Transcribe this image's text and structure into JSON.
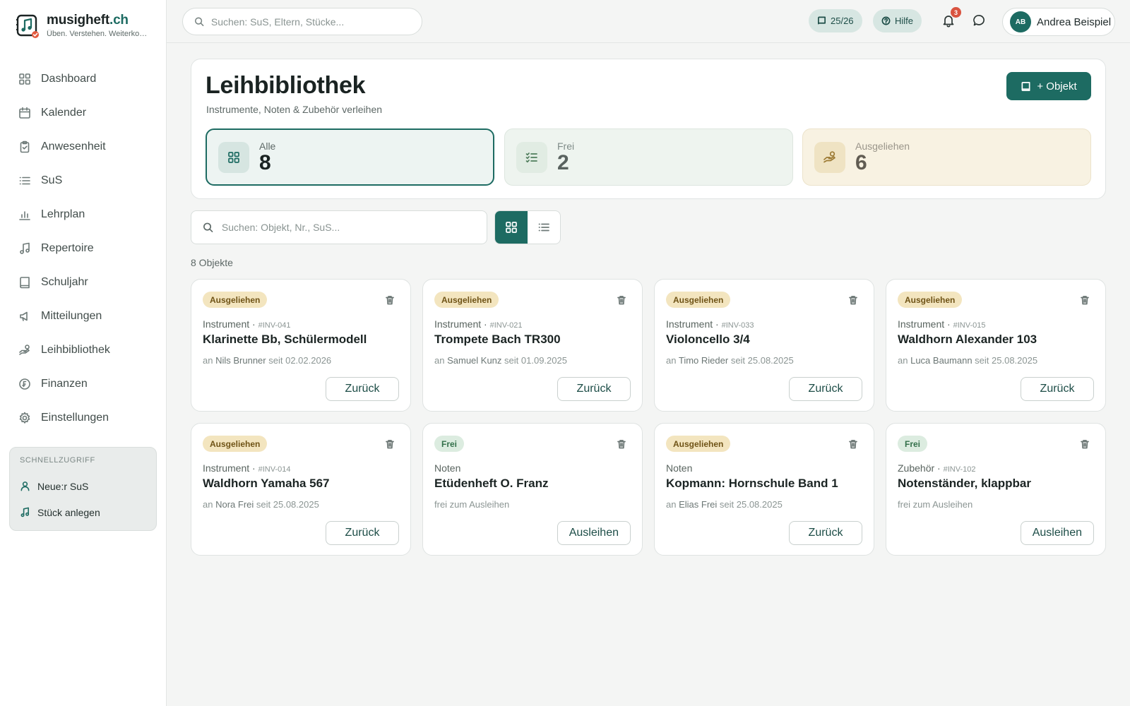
{
  "brand": {
    "name": "musigheft",
    "tld": ".ch",
    "tagline": "Üben. Verstehen. Weiterkommen."
  },
  "topbar": {
    "search_placeholder": "Suchen: SuS, Eltern, Stücke...",
    "term_label": "25/26",
    "help_label": "Hilfe",
    "notifications_count": "3",
    "user_initials": "AB",
    "user_name": "Andrea Beispiel"
  },
  "sidebar": {
    "items": [
      {
        "label": "Dashboard",
        "icon": "dashboard-icon"
      },
      {
        "label": "Kalender",
        "icon": "calendar-icon"
      },
      {
        "label": "Anwesenheit",
        "icon": "clipboard-check-icon"
      },
      {
        "label": "SuS",
        "icon": "list-icon"
      },
      {
        "label": "Lehrplan",
        "icon": "bar-chart-icon"
      },
      {
        "label": "Repertoire",
        "icon": "music-note-icon"
      },
      {
        "label": "Schuljahr",
        "icon": "book-icon"
      },
      {
        "label": "Mitteilungen",
        "icon": "megaphone-icon"
      },
      {
        "label": "Leihbibliothek",
        "icon": "hand-coins-icon"
      },
      {
        "label": "Finanzen",
        "icon": "franc-coin-icon"
      },
      {
        "label": "Einstellungen",
        "icon": "gear-icon"
      }
    ],
    "quick": {
      "title": "SCHNELLZUGRIFF",
      "items": [
        {
          "label": "Neue:r SuS",
          "icon": "user-icon"
        },
        {
          "label": "Stück anlegen",
          "icon": "music-note-icon"
        }
      ]
    }
  },
  "page": {
    "title": "Leihbibliothek",
    "subtitle": "Instrumente, Noten & Zubehör verleihen",
    "add_button": "+ Objekt",
    "stats": {
      "all": {
        "label": "Alle",
        "value": "8"
      },
      "free": {
        "label": "Frei",
        "value": "2"
      },
      "lent": {
        "label": "Ausgeliehen",
        "value": "6"
      }
    },
    "search_placeholder": "Suchen: Objekt, Nr., SuS...",
    "view_mode": "grid",
    "count_text": "8 Objekte"
  },
  "items": [
    {
      "status": "Ausgeliehen",
      "status_kind": "lent",
      "category": "Instrument",
      "inv": "#INV-041",
      "title": "Klarinette Bb, Schülermodell",
      "holder_prefix": "an",
      "holder": "Nils Brunner",
      "since_text": "seit 02.02.2026",
      "action": "Zurück"
    },
    {
      "status": "Ausgeliehen",
      "status_kind": "lent",
      "category": "Instrument",
      "inv": "#INV-021",
      "title": "Trompete Bach TR300",
      "holder_prefix": "an",
      "holder": "Samuel Kunz",
      "since_text": "seit 01.09.2025",
      "action": "Zurück"
    },
    {
      "status": "Ausgeliehen",
      "status_kind": "lent",
      "category": "Instrument",
      "inv": "#INV-033",
      "title": "Violoncello 3/4",
      "holder_prefix": "an",
      "holder": "Timo Rieder",
      "since_text": "seit 25.08.2025",
      "action": "Zurück"
    },
    {
      "status": "Ausgeliehen",
      "status_kind": "lent",
      "category": "Instrument",
      "inv": "#INV-015",
      "title": "Waldhorn Alexander 103",
      "holder_prefix": "an",
      "holder": "Luca Baumann",
      "since_text": "seit 25.08.2025",
      "action": "Zurück"
    },
    {
      "status": "Ausgeliehen",
      "status_kind": "lent",
      "category": "Instrument",
      "inv": "#INV-014",
      "title": "Waldhorn Yamaha 567",
      "holder_prefix": "an",
      "holder": "Nora Frei",
      "since_text": "seit 25.08.2025",
      "action": "Zurück"
    },
    {
      "status": "Frei",
      "status_kind": "free",
      "category": "Noten",
      "inv": "",
      "title": "Etüdenheft O. Franz",
      "holder_prefix": "frei zum Ausleihen",
      "holder": "",
      "since_text": "",
      "action": "Ausleihen"
    },
    {
      "status": "Ausgeliehen",
      "status_kind": "lent",
      "category": "Noten",
      "inv": "",
      "title": "Kopmann: Hornschule Band 1",
      "holder_prefix": "an",
      "holder": "Elias Frei",
      "since_text": "seit 25.08.2025",
      "action": "Zurück"
    },
    {
      "status": "Frei",
      "status_kind": "free",
      "category": "Zubehör",
      "inv": "#INV-102",
      "title": "Notenständer, klappbar",
      "holder_prefix": "frei zum Ausleihen",
      "holder": "",
      "since_text": "",
      "action": "Ausleihen"
    }
  ],
  "colors": {
    "accent": "#1d6b62",
    "lent_badge": "#f3e5bf",
    "free_badge": "#dcece0",
    "notification": "#d9533f"
  }
}
